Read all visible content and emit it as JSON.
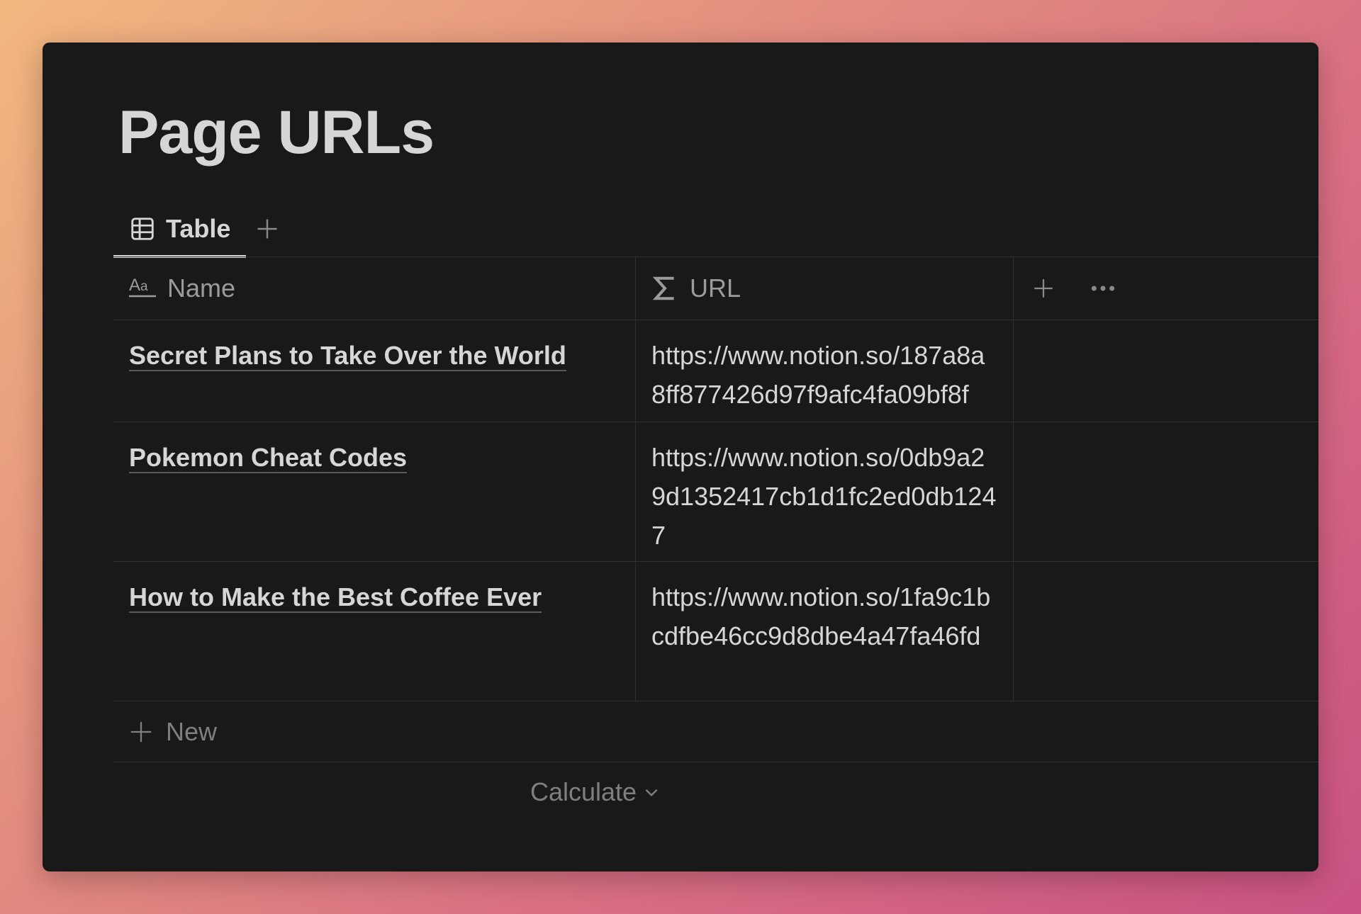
{
  "page": {
    "title": "Page URLs"
  },
  "views": {
    "tabs": [
      {
        "label": "Table",
        "icon": "table-icon",
        "active": true
      }
    ],
    "add_icon": "plus-icon"
  },
  "table": {
    "columns": [
      {
        "label": "Name",
        "icon": "text-property-icon"
      },
      {
        "label": "URL",
        "icon": "formula-sigma-icon"
      }
    ],
    "header_actions": {
      "add_icon": "plus-icon",
      "more_icon": "ellipsis-icon"
    },
    "rows": [
      {
        "name": "Secret Plans to Take Over the World",
        "url": "https://www.notion.so/187a8a8ff877426d97f9afc4fa09bf8f"
      },
      {
        "name": "Pokemon Cheat Codes",
        "url": "https://www.notion.so/0db9a29d1352417cb1d1fc2ed0db1247"
      },
      {
        "name": "How to Make the Best Coffee Ever",
        "url": "https://www.notion.so/1fa9c1bcdfbe46cc9d8dbe4a47fa46fd"
      }
    ],
    "new_row_label": "New",
    "calculate_label": "Calculate"
  },
  "colors": {
    "background": "#191919",
    "text": "#d6d6d6",
    "muted_text": "#9b9b9b",
    "divider": "#2f2f2f"
  }
}
